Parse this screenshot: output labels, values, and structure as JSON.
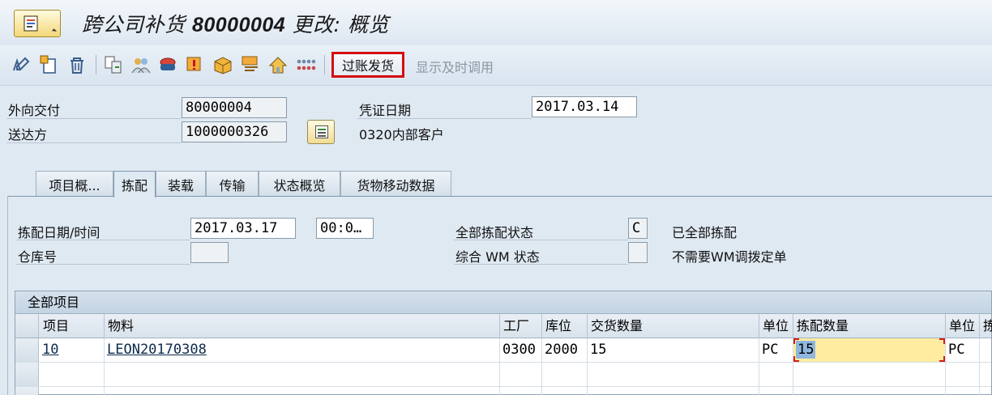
{
  "title": {
    "prefix": "跨公司补货",
    "number": "80000004",
    "suffix": "更改: 概览"
  },
  "toolbar": {
    "icons": [
      "edit-icon",
      "create-icon",
      "delete-icon",
      "document-flow-icon",
      "partner-icon",
      "print-icon",
      "message-icon",
      "package-icon",
      "output-icon",
      "shipment-icon",
      "items-icon"
    ],
    "post_goods_issue": "过账发货",
    "display_timely": "显示及时调用"
  },
  "header": {
    "outbound_delivery_label": "外向交付",
    "outbound_delivery_value": "80000004",
    "ship_to_label": "送达方",
    "ship_to_value": "1000000326",
    "ship_to_name": "0320内部客户",
    "doc_date_label": "凭证日期",
    "doc_date_value": "2017.03.14"
  },
  "tabs": [
    {
      "label": "项目概..."
    },
    {
      "label": "拣配"
    },
    {
      "label": "装载"
    },
    {
      "label": "传输"
    },
    {
      "label": "状态概览"
    },
    {
      "label": "货物移动数据"
    }
  ],
  "picking": {
    "date_time_label": "拣配日期/时间",
    "date_value": "2017.03.17",
    "time_value": "00:0…",
    "warehouse_label": "仓库号",
    "warehouse_value": "",
    "overall_status_label": "全部拣配状态",
    "overall_status_value": "C",
    "overall_status_text": "已全部拣配",
    "wm_status_label": "综合 WM 状态",
    "wm_status_value": "",
    "wm_status_text": "不需要WM调拨定单"
  },
  "items_table": {
    "title": "全部项目",
    "columns": {
      "item": "项目",
      "material": "物料",
      "plant": "工厂",
      "sloc": "库位",
      "deliv_qty": "交货数量",
      "unit": "单位",
      "pick_qty": "拣配数量",
      "unit2": "单位",
      "extra": "拣"
    },
    "rows": [
      {
        "item": "10",
        "material": "LEON20170308",
        "plant": "0300",
        "sloc": "2000",
        "deliv_qty": "15",
        "unit": "PC",
        "pick_qty": "15",
        "unit2": "PC"
      }
    ]
  }
}
